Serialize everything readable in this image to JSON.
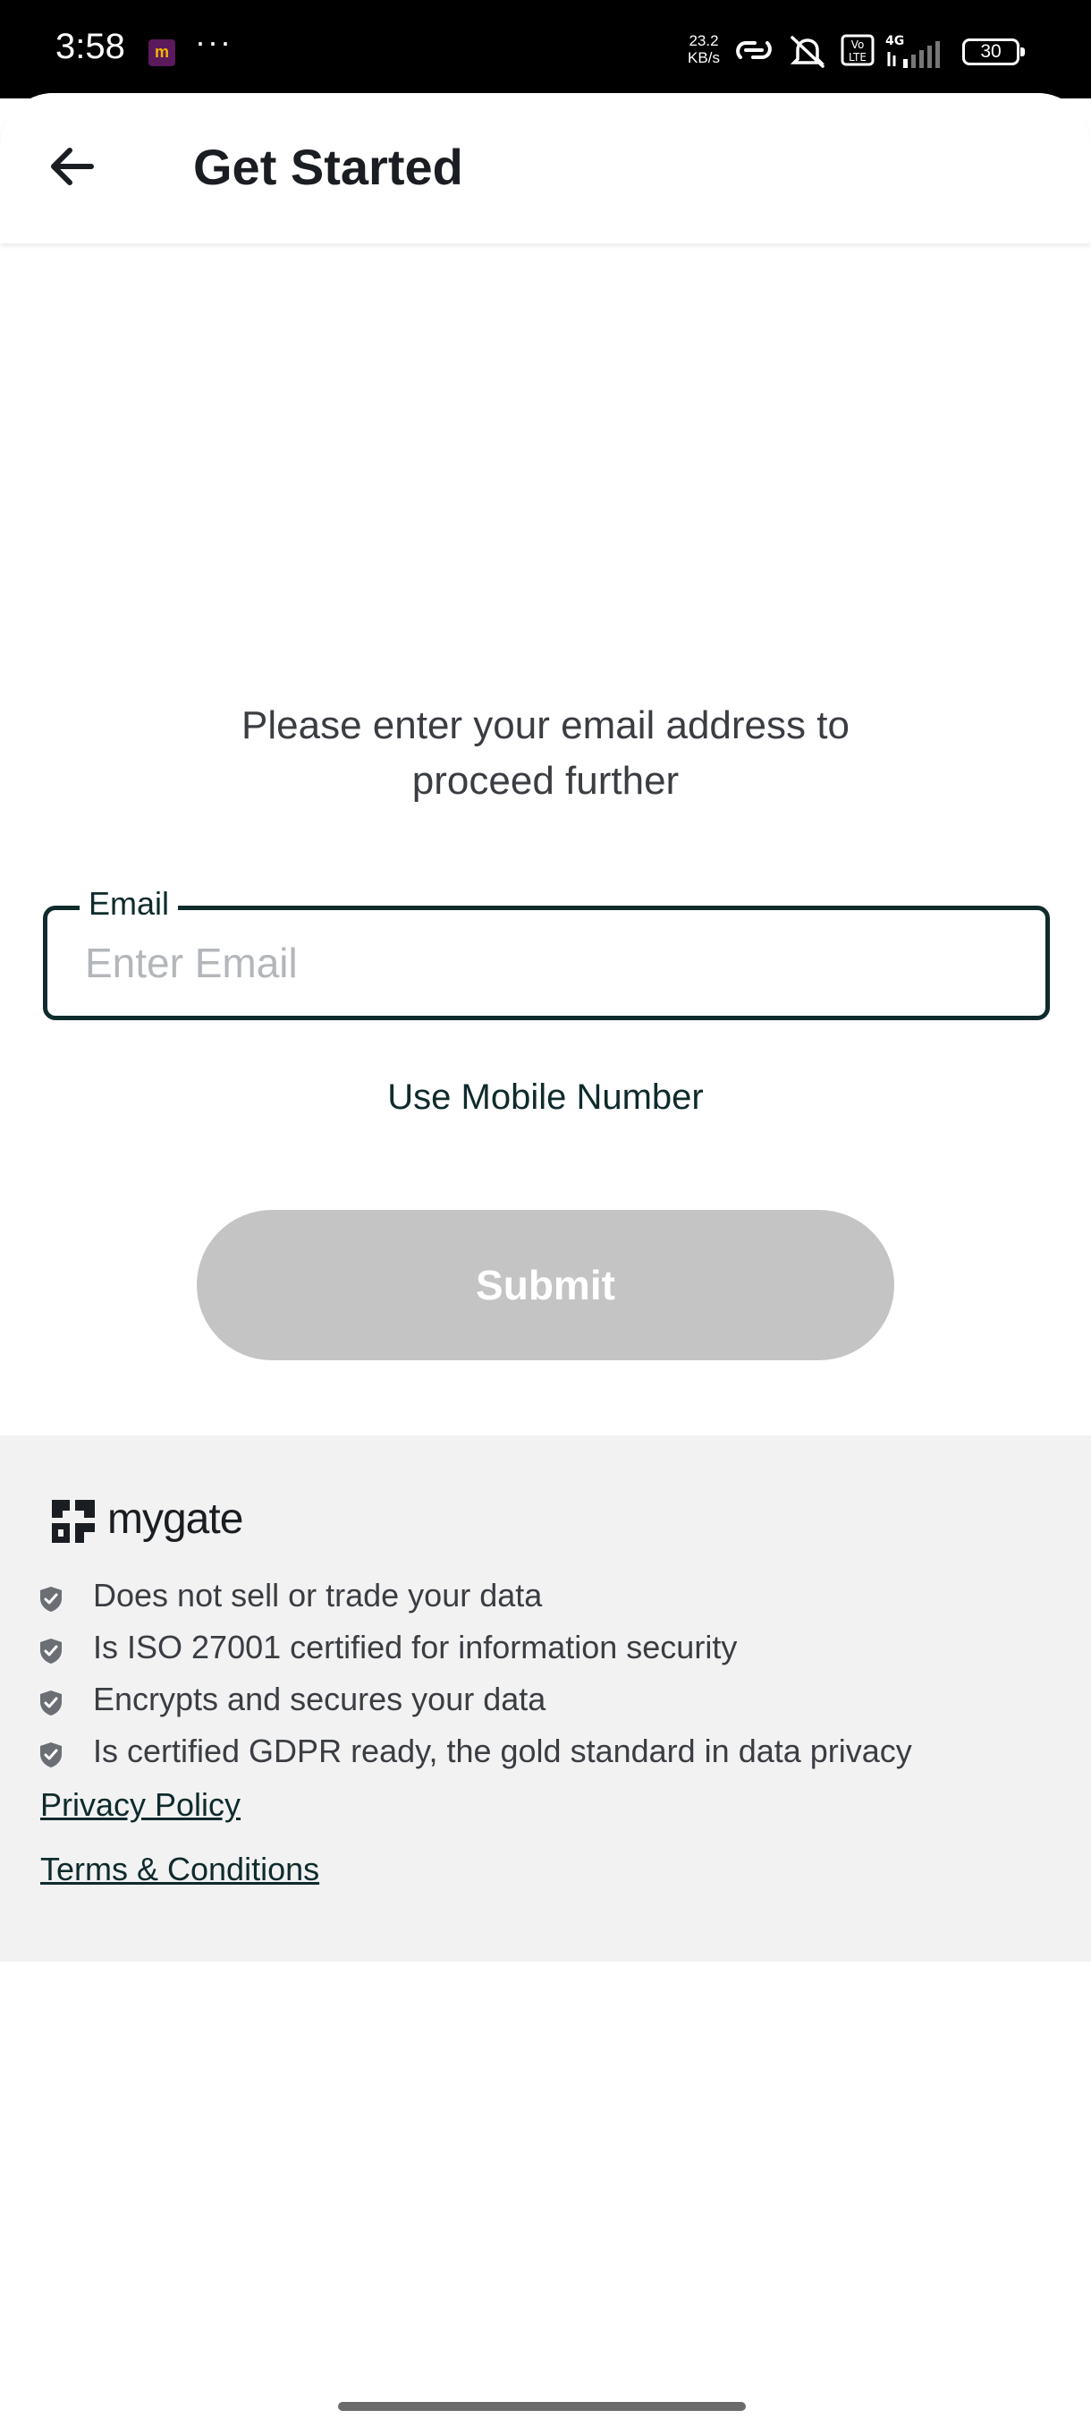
{
  "status_bar": {
    "time": "3:58",
    "app_icon_letter": "m",
    "more": "···",
    "net_speed_value": "23.2",
    "net_speed_unit": "KB/s",
    "network_type": "4G",
    "volte": "Vo LTE",
    "battery": "30"
  },
  "header": {
    "title": "Get Started",
    "back_icon": "arrow-left-icon"
  },
  "main": {
    "instruction": "Please enter your email address to proceed further",
    "email_label": "Email",
    "email_placeholder": "Enter Email",
    "email_value": "",
    "alt_login": "Use Mobile Number",
    "submit_label": "Submit",
    "submit_color": "#c4c4c4",
    "field_border_color": "#0f2b2c"
  },
  "trust": {
    "brand": "mygate",
    "items": [
      "Does not sell or trade your data",
      "Is ISO 27001 certified for information security",
      "Encrypts and secures your data",
      "Is certified GDPR ready, the gold standard in data privacy"
    ],
    "privacy_policy": "Privacy Policy",
    "terms": "Terms & Conditions",
    "background": "#f2f2f2"
  }
}
